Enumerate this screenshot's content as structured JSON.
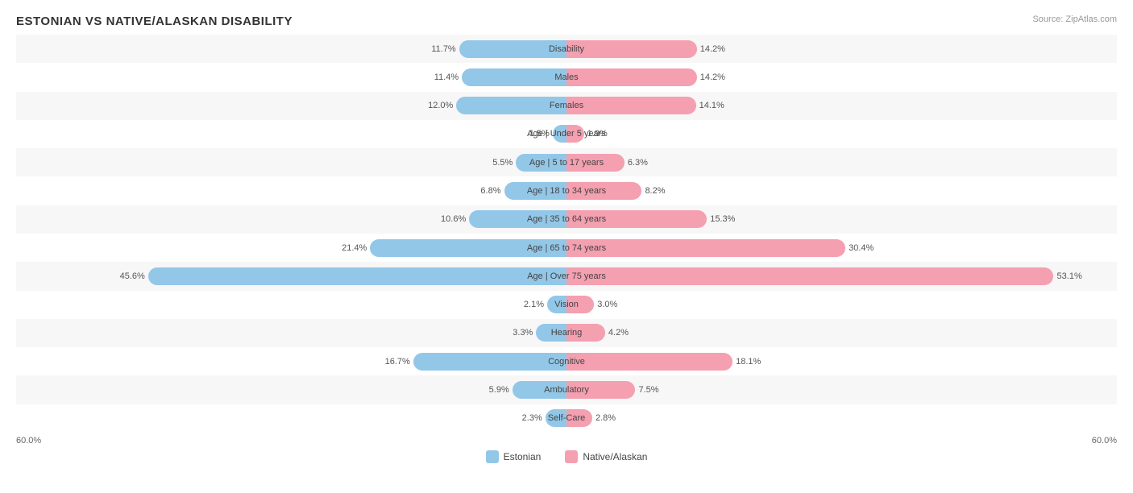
{
  "title": "ESTONIAN VS NATIVE/ALASKAN DISABILITY",
  "source": "Source: ZipAtlas.com",
  "colors": {
    "estonian": "#93c7e8",
    "native": "#f4a0b0"
  },
  "legend": {
    "estonian_label": "Estonian",
    "native_label": "Native/Alaskan"
  },
  "axis": {
    "left": "60.0%",
    "right": "60.0%"
  },
  "rows": [
    {
      "label": "Disability",
      "left_val": "11.7%",
      "right_val": "14.2%",
      "left_pct": 11.7,
      "right_pct": 14.2
    },
    {
      "label": "Males",
      "left_val": "11.4%",
      "right_val": "14.2%",
      "left_pct": 11.4,
      "right_pct": 14.2
    },
    {
      "label": "Females",
      "left_val": "12.0%",
      "right_val": "14.1%",
      "left_pct": 12.0,
      "right_pct": 14.1
    },
    {
      "label": "Age | Under 5 years",
      "left_val": "1.5%",
      "right_val": "1.9%",
      "left_pct": 1.5,
      "right_pct": 1.9
    },
    {
      "label": "Age | 5 to 17 years",
      "left_val": "5.5%",
      "right_val": "6.3%",
      "left_pct": 5.5,
      "right_pct": 6.3
    },
    {
      "label": "Age | 18 to 34 years",
      "left_val": "6.8%",
      "right_val": "8.2%",
      "left_pct": 6.8,
      "right_pct": 8.2
    },
    {
      "label": "Age | 35 to 64 years",
      "left_val": "10.6%",
      "right_val": "15.3%",
      "left_pct": 10.6,
      "right_pct": 15.3
    },
    {
      "label": "Age | 65 to 74 years",
      "left_val": "21.4%",
      "right_val": "30.4%",
      "left_pct": 21.4,
      "right_pct": 30.4
    },
    {
      "label": "Age | Over 75 years",
      "left_val": "45.6%",
      "right_val": "53.1%",
      "left_pct": 45.6,
      "right_pct": 53.1
    },
    {
      "label": "Vision",
      "left_val": "2.1%",
      "right_val": "3.0%",
      "left_pct": 2.1,
      "right_pct": 3.0
    },
    {
      "label": "Hearing",
      "left_val": "3.3%",
      "right_val": "4.2%",
      "left_pct": 3.3,
      "right_pct": 4.2
    },
    {
      "label": "Cognitive",
      "left_val": "16.7%",
      "right_val": "18.1%",
      "left_pct": 16.7,
      "right_pct": 18.1
    },
    {
      "label": "Ambulatory",
      "left_val": "5.9%",
      "right_val": "7.5%",
      "left_pct": 5.9,
      "right_pct": 7.5
    },
    {
      "label": "Self-Care",
      "left_val": "2.3%",
      "right_val": "2.8%",
      "left_pct": 2.3,
      "right_pct": 2.8
    }
  ],
  "max_pct": 60
}
